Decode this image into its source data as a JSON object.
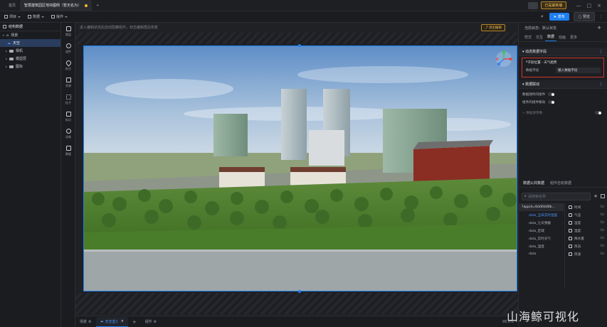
{
  "titlebar": {
    "home_tab": "首页",
    "doc_tab": "智慧建筑园区地块图例（暂无名为）",
    "version_badge": "已是最新版",
    "add_tab": "+"
  },
  "toolbar": {
    "menu_project": "项目",
    "menu_data": "数据",
    "menu_ops": "操作",
    "publish": "发布",
    "preview": "预览"
  },
  "tree": {
    "title": "结构数据",
    "items": [
      {
        "label": "场景"
      },
      {
        "label": "天空"
      },
      {
        "label": "相机"
      },
      {
        "label": "模型层"
      },
      {
        "label": "图标"
      }
    ]
  },
  "strip": [
    {
      "label": "图层"
    },
    {
      "label": "组件"
    },
    {
      "label": "标注"
    },
    {
      "label": "资源"
    },
    {
      "label": "粒子"
    },
    {
      "label": "标记"
    },
    {
      "label": "动效"
    },
    {
      "label": "数据"
    }
  ],
  "canvas": {
    "hint": "进入编辑状态后自动隐藏组件，双击编辑框后恢复",
    "exit_btn": "退出编辑"
  },
  "bottom": {
    "tabs": [
      {
        "label": "场景"
      },
      {
        "label": "天空盒1"
      }
    ],
    "add": "+",
    "tab_more": "组件",
    "zoom": "95.0%"
  },
  "right": {
    "state_label": "当前状态：默认状态",
    "tabs": [
      "样式",
      "交互",
      "数据",
      "动画",
      "更多"
    ],
    "section_dynamic": "动态数据字段",
    "sub_title": "子段位置 - 天气趋势",
    "field_label": "数据字段",
    "field_value": "输入数据字段",
    "section_bind": "数据联动",
    "row_auto": "数据随时间组件",
    "row_poll": "组件的组件联动",
    "row_more": "数据源参数",
    "tab_public": "数据公共数据",
    "tab_component": "组件自有数据",
    "search_placeholder": "请搜索名称",
    "api_text": "?appid=6dd0dd0b...",
    "data_list": [
      {
        "label": "data_当日实时温度",
        "selected": true
      },
      {
        "label": "data_七天预报"
      },
      {
        "label": "data_区域"
      },
      {
        "label": "data_实时天气"
      },
      {
        "label": "data_温度"
      },
      {
        "label": "data"
      }
    ],
    "fields": [
      {
        "label": "时间",
        "value": "Str"
      },
      {
        "label": "气压",
        "value": "Str"
      },
      {
        "label": "湿度",
        "value": "Str"
      },
      {
        "label": "温度",
        "value": "Str"
      },
      {
        "label": "降水量",
        "value": "Str"
      },
      {
        "label": "风向",
        "value": "Str"
      },
      {
        "label": "风速",
        "value": "Str"
      }
    ]
  },
  "watermark": "山海鲸可视化",
  "colors": {
    "accent": "#1d7ff0",
    "warn": "#f2b824",
    "highlight_box": "#d0342c"
  }
}
